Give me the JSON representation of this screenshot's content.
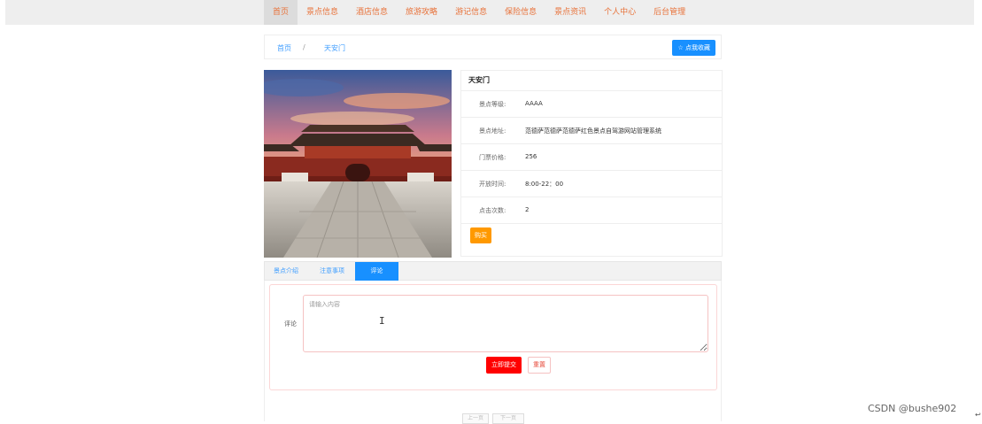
{
  "nav": {
    "items": [
      {
        "label": "首页",
        "active": true
      },
      {
        "label": "景点信息"
      },
      {
        "label": "酒店信息"
      },
      {
        "label": "旅游攻略"
      },
      {
        "label": "游记信息"
      },
      {
        "label": "保险信息"
      },
      {
        "label": "景点资讯"
      },
      {
        "label": "个人中心"
      },
      {
        "label": "后台管理"
      }
    ],
    "accent_color": "#e8723a"
  },
  "breadcrumb": {
    "home": "首页",
    "separator": "/",
    "current": "天安门"
  },
  "favorite_button": {
    "icon": "star-outline-icon",
    "label": "点我收藏"
  },
  "attraction": {
    "name": "天安门",
    "rows": [
      {
        "label": "景点等级:",
        "value": "AAAA"
      },
      {
        "label": "景点地址:",
        "value": "范德萨范德萨范德萨红色景点自驾游网站管理系统"
      },
      {
        "label": "门票价格:",
        "value": "256"
      },
      {
        "label": "开放时间:",
        "value": "8:00-22：00"
      },
      {
        "label": "点击次数:",
        "value": "2"
      }
    ],
    "buy_label": "购买"
  },
  "tabs": [
    {
      "label": "景点介绍"
    },
    {
      "label": "注意事项"
    },
    {
      "label": "评论",
      "active": true
    }
  ],
  "comment": {
    "label": "评论",
    "placeholder": "请输入内容",
    "submit_label": "立即提交",
    "reset_label": "重置"
  },
  "pager": {
    "prev": "上一页",
    "next": "下一页"
  },
  "watermark": "CSDN @bushe902",
  "corner_mark": "↩",
  "colors": {
    "primary_blue": "#1890ff",
    "buy_orange": "#ff9900",
    "submit_red": "#ff0000"
  }
}
